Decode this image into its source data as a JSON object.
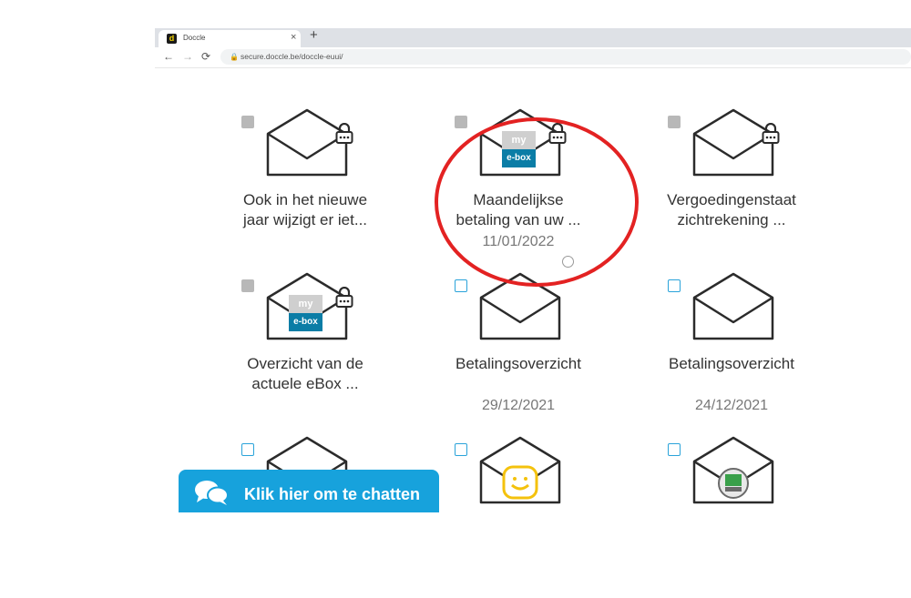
{
  "browser": {
    "tab_title": "Doccle",
    "tab_close": "×",
    "new_tab": "+",
    "back": "←",
    "forward": "→",
    "reload": "⟳",
    "url": "secure.doccle.be/doccle-euui/",
    "favicon_letter": "d"
  },
  "documents": [
    {
      "title": "Ook in het nieuwe\njaar wijzigt er iet...",
      "date": "",
      "checkbox": "grey",
      "icon": "envelope-open-icon",
      "locked": true
    },
    {
      "title": "Maandelijkse\nbetaling van uw ...",
      "date": "11/01/2022",
      "checkbox": "grey",
      "icon": "my-ebox-logo",
      "locked": true
    },
    {
      "title": "Vergoedingenstaat\nzichtrekening ...",
      "date": "",
      "checkbox": "grey",
      "icon": "envelope-open-icon",
      "locked": true
    },
    {
      "title": "Overzicht van de\nactuele eBox ...",
      "date": "",
      "checkbox": "grey",
      "icon": "my-ebox-logo",
      "locked": true
    },
    {
      "title": "Betalingsoverzicht",
      "date": "29/12/2021",
      "checkbox": "blue",
      "icon": "envelope-open-icon",
      "locked": false
    },
    {
      "title": "Betalingsoverzicht",
      "date": "24/12/2021",
      "checkbox": "blue",
      "icon": "envelope-open-icon",
      "locked": false
    },
    {
      "title": "",
      "date": "",
      "checkbox": "blue",
      "icon": "envelope-open-icon",
      "locked": false
    },
    {
      "title": "",
      "date": "",
      "checkbox": "blue",
      "icon": "smiley-logo",
      "locked": false
    },
    {
      "title": "",
      "date": "",
      "checkbox": "blue",
      "icon": "mm-logo",
      "locked": false
    }
  ],
  "ebox": {
    "my": "my",
    "ebox": "e-box"
  },
  "chat": {
    "label": "Klik hier om te chatten"
  },
  "colors": {
    "accent": "#17a2dc",
    "highlight": "#e32222",
    "ebox_blue": "#0b7da6"
  }
}
